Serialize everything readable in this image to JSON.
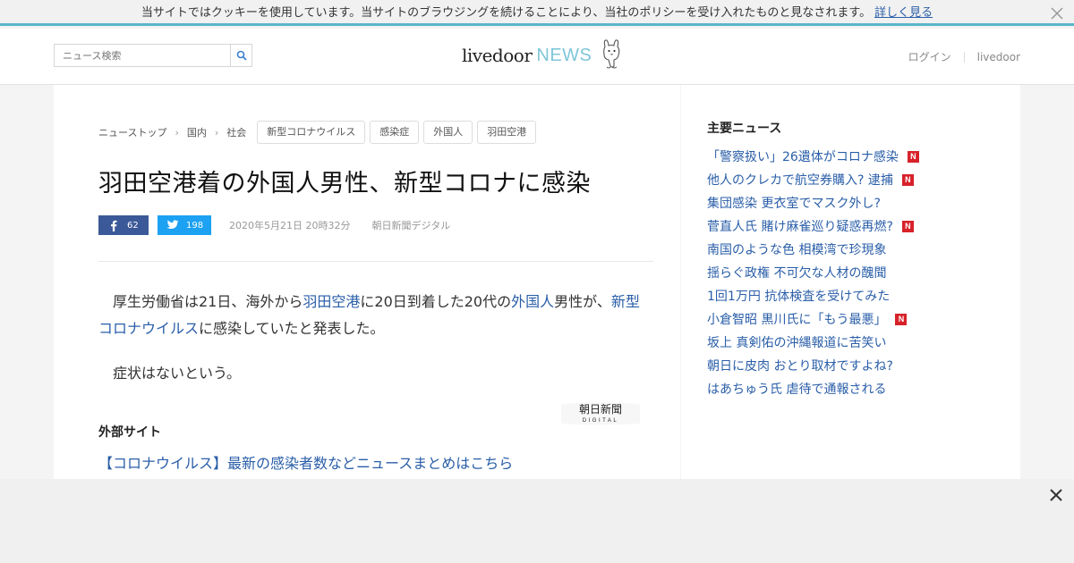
{
  "cookie": {
    "message": "当サイトではクッキーを使用しています。当サイトのブラウジングを続けることにより、当社のポリシーを受け入れたものと見なされます。",
    "link": "詳しく見る"
  },
  "header": {
    "search_placeholder": "ニュース検索",
    "logo_main": "livedoor",
    "logo_news": "NEWS",
    "login": "ログイン",
    "livedoor_link": "livedoor"
  },
  "breadcrumb": [
    "ニューストップ",
    "国内",
    "社会"
  ],
  "tags": [
    "新型コロナウイルス",
    "感染症",
    "外国人",
    "羽田空港"
  ],
  "article": {
    "title": "羽田空港着の外国人男性、新型コロナに感染",
    "fb_count": "62",
    "tw_count": "198",
    "date": "2020年5月21日 20時32分",
    "source": "朝日新聞デジタル",
    "para1": [
      {
        "t": "厚生労働省は21日、海外から",
        "link": false
      },
      {
        "t": "羽田空港",
        "link": true
      },
      {
        "t": "に20日到着した20代の",
        "link": false
      },
      {
        "t": "外国人",
        "link": true
      },
      {
        "t": "男性が、",
        "link": false
      },
      {
        "t": "新型コロナウイルス",
        "link": true
      },
      {
        "t": "に感染していたと発表した。",
        "link": false
      }
    ],
    "para2": "症状はないという。",
    "source_logo_line1": "朝日新聞",
    "source_logo_line2": "DIGITAL",
    "external_heading": "外部サイト",
    "external_link": "【コロナウイルス】最新の感染者数などニュースまとめはこちら"
  },
  "sidebar": {
    "heading": "主要ニュース",
    "new_badge": "N",
    "items": [
      {
        "label": "「警察扱い」26遺体がコロナ感染",
        "new": true
      },
      {
        "label": "他人のクレカで航空券購入? 逮捕",
        "new": true
      },
      {
        "label": "集団感染 更衣室でマスク外し?",
        "new": false
      },
      {
        "label": "菅直人氏 賭け麻雀巡り疑惑再燃?",
        "new": true
      },
      {
        "label": "南国のような色 相模湾で珍現象",
        "new": false
      },
      {
        "label": "揺らぐ政権 不可欠な人材の醜聞",
        "new": false
      },
      {
        "label": "1回1万円 抗体検査を受けてみた",
        "new": false
      },
      {
        "label": "小倉智昭 黒川氏に「もう最悪」",
        "new": true
      },
      {
        "label": "坂上 真剣佑の沖縄報道に苦笑い",
        "new": false
      },
      {
        "label": "朝日に皮肉 おとり取材ですよね?",
        "new": false
      },
      {
        "label": "はあちゅう氏 虐待で通報される",
        "new": false
      }
    ]
  },
  "colors": {
    "link": "#2a5ea8",
    "accent_line": "#59b6c9",
    "facebook": "#3b5998",
    "twitter": "#1da1f2",
    "badge_red": "#d7222a"
  }
}
